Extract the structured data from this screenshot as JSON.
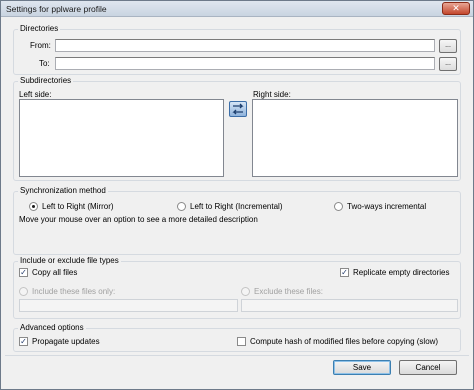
{
  "window": {
    "title": "Settings for pplware profile"
  },
  "directories": {
    "group_title": "Directories",
    "from_label": "From:",
    "from_value": "",
    "to_label": "To:",
    "to_value": "",
    "browse_label": "..."
  },
  "subdirectories": {
    "group_title": "Subdirectories",
    "left_label": "Left side:",
    "right_label": "Right side:",
    "swap_icon": "swap-arrows-icon"
  },
  "sync": {
    "group_title": "Synchronization method",
    "options": [
      "Left to Right (Mirror)",
      "Left to Right (Incremental)",
      "Two-ways incremental"
    ],
    "selected": "Left to Right (Mirror)",
    "description": "Move your mouse over an option to see a more detailed description"
  },
  "filetypes": {
    "group_title": "Include or exclude file types",
    "copy_all": "Copy all files",
    "replicate_empty": "Replicate empty directories",
    "include_only": "Include these files only:",
    "exclude": "Exclude these files:"
  },
  "advanced": {
    "group_title": "Advanced options",
    "propagate": "Propagate updates",
    "compute_hash": "Compute hash of modified files before copying (slow)"
  },
  "buttons": {
    "save": "Save",
    "cancel": "Cancel"
  }
}
